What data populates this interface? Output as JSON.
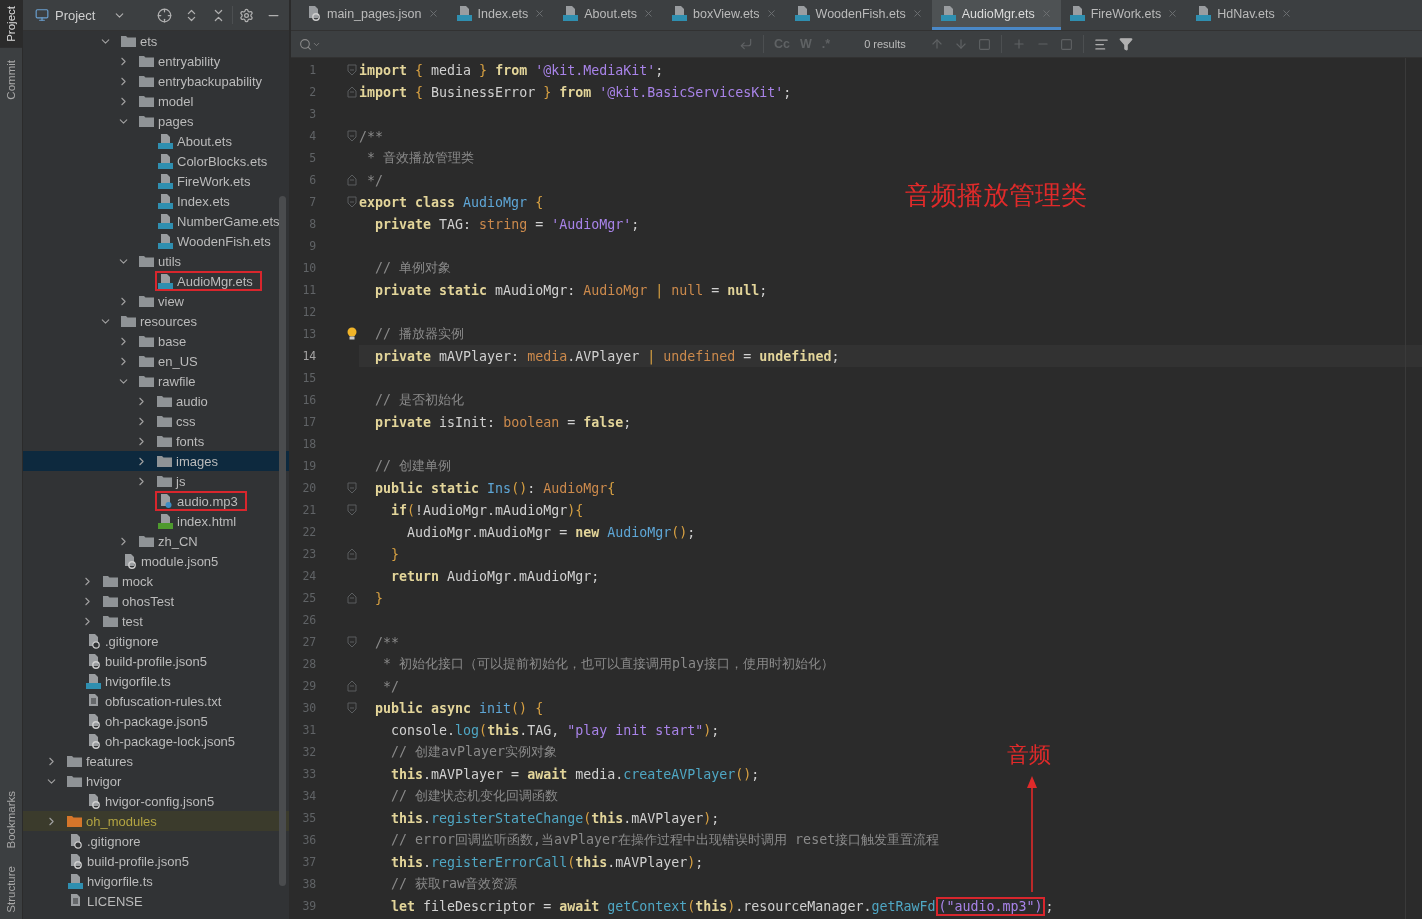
{
  "tool_windows": {
    "top": [
      {
        "label": "Project",
        "selected": true
      },
      {
        "label": "Commit",
        "selected": false
      }
    ],
    "bottom": [
      {
        "label": "Bookmarks",
        "selected": false
      },
      {
        "label": "Structure",
        "selected": false
      }
    ]
  },
  "project_panel": {
    "title": "Project"
  },
  "tree": [
    {
      "children": [
        {
          "children": [
            {
              "children": [
                {
                  "label": "ets",
                  "kind": "folder",
                  "expanded": true,
                  "selected": false,
                  "highlighted": false,
                  "excluded": false,
                  "children": [
                    {
                      "label": "entryability",
                      "kind": "folder",
                      "expanded": false,
                      "selected": false,
                      "highlighted": false,
                      "excluded": false
                    },
                    {
                      "label": "entrybackupability",
                      "kind": "folder",
                      "expanded": false,
                      "selected": false,
                      "highlighted": false,
                      "excluded": false
                    },
                    {
                      "label": "model",
                      "kind": "folder",
                      "expanded": false,
                      "selected": false,
                      "highlighted": false,
                      "excluded": false
                    },
                    {
                      "label": "pages",
                      "kind": "folder",
                      "expanded": true,
                      "selected": false,
                      "highlighted": false,
                      "excluded": false,
                      "children": [
                        {
                          "label": "About.ets",
                          "kind": "ets",
                          "selected": false,
                          "highlighted": false,
                          "excluded": false
                        },
                        {
                          "label": "ColorBlocks.ets",
                          "kind": "ets",
                          "selected": false,
                          "highlighted": false,
                          "excluded": false
                        },
                        {
                          "label": "FireWork.ets",
                          "kind": "ets",
                          "selected": false,
                          "highlighted": false,
                          "excluded": false
                        },
                        {
                          "label": "Index.ets",
                          "kind": "ets",
                          "selected": false,
                          "highlighted": false,
                          "excluded": false
                        },
                        {
                          "label": "NumberGame.ets",
                          "kind": "ets",
                          "selected": false,
                          "highlighted": false,
                          "excluded": false
                        },
                        {
                          "label": "WoodenFish.ets",
                          "kind": "ets",
                          "selected": false,
                          "highlighted": false,
                          "excluded": false
                        }
                      ]
                    },
                    {
                      "label": "utils",
                      "kind": "folder",
                      "expanded": true,
                      "selected": false,
                      "highlighted": false,
                      "excluded": false,
                      "children": [
                        {
                          "label": "AudioMgr.ets",
                          "kind": "ets",
                          "selected": false,
                          "highlighted": true,
                          "excluded": false
                        }
                      ]
                    },
                    {
                      "label": "view",
                      "kind": "folder",
                      "expanded": false,
                      "selected": false,
                      "highlighted": false,
                      "excluded": false
                    }
                  ]
                },
                {
                  "label": "resources",
                  "kind": "folder",
                  "expanded": true,
                  "selected": false,
                  "highlighted": false,
                  "excluded": false,
                  "children": [
                    {
                      "label": "base",
                      "kind": "folder",
                      "expanded": false,
                      "selected": false,
                      "highlighted": false,
                      "excluded": false
                    },
                    {
                      "label": "en_US",
                      "kind": "folder",
                      "expanded": false,
                      "selected": false,
                      "highlighted": false,
                      "excluded": false
                    },
                    {
                      "label": "rawfile",
                      "kind": "folder",
                      "expanded": true,
                      "selected": false,
                      "highlighted": false,
                      "excluded": false,
                      "children": [
                        {
                          "label": "audio",
                          "kind": "folder",
                          "expanded": false,
                          "selected": false,
                          "highlighted": false,
                          "excluded": false
                        },
                        {
                          "label": "css",
                          "kind": "folder",
                          "expanded": false,
                          "selected": false,
                          "highlighted": false,
                          "excluded": false
                        },
                        {
                          "label": "fonts",
                          "kind": "folder",
                          "expanded": false,
                          "selected": false,
                          "highlighted": false,
                          "excluded": false
                        },
                        {
                          "label": "images",
                          "kind": "folder",
                          "expanded": false,
                          "selected": true,
                          "highlighted": false,
                          "excluded": false
                        },
                        {
                          "label": "js",
                          "kind": "folder",
                          "expanded": false,
                          "selected": false,
                          "highlighted": false,
                          "excluded": false
                        },
                        {
                          "label": "audio.mp3",
                          "kind": "unknown",
                          "selected": false,
                          "highlighted": true,
                          "excluded": false
                        },
                        {
                          "label": "index.html",
                          "kind": "html",
                          "selected": false,
                          "highlighted": false,
                          "excluded": false
                        }
                      ]
                    },
                    {
                      "label": "zh_CN",
                      "kind": "folder",
                      "expanded": false,
                      "selected": false,
                      "highlighted": false,
                      "excluded": false
                    }
                  ]
                },
                {
                  "label": "module.json5",
                  "kind": "json",
                  "selected": false,
                  "highlighted": false,
                  "excluded": false
                }
              ]
            },
            {
              "label": "mock",
              "kind": "folder",
              "expanded": false,
              "selected": false,
              "highlighted": false,
              "excluded": false
            },
            {
              "label": "ohosTest",
              "kind": "folder",
              "expanded": false,
              "selected": false,
              "highlighted": false,
              "excluded": false
            },
            {
              "label": "test",
              "kind": "folder",
              "expanded": false,
              "selected": false,
              "highlighted": false,
              "excluded": false
            }
          ]
        },
        {
          "label": ".gitignore",
          "kind": "ignore",
          "selected": false,
          "highlighted": false,
          "excluded": false
        },
        {
          "label": "build-profile.json5",
          "kind": "json",
          "selected": false,
          "highlighted": false,
          "excluded": false
        },
        {
          "label": "hvigorfile.ts",
          "kind": "ts",
          "selected": false,
          "highlighted": false,
          "excluded": false
        },
        {
          "label": "obfuscation-rules.txt",
          "kind": "txt",
          "selected": false,
          "highlighted": false,
          "excluded": false
        },
        {
          "label": "oh-package.json5",
          "kind": "json",
          "selected": false,
          "highlighted": false,
          "excluded": false
        },
        {
          "label": "oh-package-lock.json5",
          "kind": "json",
          "selected": false,
          "highlighted": false,
          "excluded": false
        }
      ]
    },
    {
      "label": "features",
      "kind": "folder",
      "expanded": false,
      "selected": false,
      "highlighted": false,
      "excluded": false
    },
    {
      "label": "hvigor",
      "kind": "folder",
      "expanded": true,
      "selected": false,
      "highlighted": false,
      "excluded": false,
      "children": [
        {
          "label": "hvigor-config.json5",
          "kind": "json",
          "selected": false,
          "highlighted": false,
          "excluded": false
        }
      ]
    },
    {
      "label": "oh_modules",
      "kind": "folder",
      "expanded": false,
      "selected": false,
      "highlighted": false,
      "excluded": true
    },
    {
      "label": ".gitignore",
      "kind": "ignore",
      "selected": false,
      "highlighted": false,
      "excluded": false
    },
    {
      "label": "build-profile.json5",
      "kind": "json",
      "selected": false,
      "highlighted": false,
      "excluded": false
    },
    {
      "label": "hvigorfile.ts",
      "kind": "ts",
      "selected": false,
      "highlighted": false,
      "excluded": false
    },
    {
      "label": "LICENSE",
      "kind": "txt",
      "selected": false,
      "highlighted": false,
      "excluded": false
    }
  ],
  "tabs": [
    {
      "label": "main_pages.json",
      "kind": "json",
      "selected": false
    },
    {
      "label": "Index.ets",
      "kind": "ets",
      "selected": false
    },
    {
      "label": "About.ets",
      "kind": "ets",
      "selected": false
    },
    {
      "label": "boxView.ets",
      "kind": "ets",
      "selected": false
    },
    {
      "label": "WoodenFish.ets",
      "kind": "ets",
      "selected": false
    },
    {
      "label": "AudioMgr.ets",
      "kind": "ets",
      "selected": true
    },
    {
      "label": "FireWork.ets",
      "kind": "ets",
      "selected": false
    },
    {
      "label": "HdNav.ets",
      "kind": "ets",
      "selected": false
    }
  ],
  "find_bar": {
    "options": [
      "Cc",
      "W",
      ".*"
    ],
    "results": "0 results"
  },
  "code": [
    {
      "number": "1",
      "fold_start": true,
      "current": false,
      "tokens": [
        {
          "kind": "kw",
          "text": "import"
        },
        {
          "kind": "br",
          "text": " {"
        },
        {
          "kind": "p",
          "text": " media "
        },
        {
          "kind": "br",
          "text": "}"
        },
        {
          "kind": "kw",
          "text": " from"
        },
        {
          "kind": "str",
          "text": " '@kit.MediaKit'"
        },
        {
          "kind": "p",
          "text": ";"
        }
      ]
    },
    {
      "number": "2",
      "fold_end": true,
      "current": false,
      "tokens": [
        {
          "kind": "kw",
          "text": "import"
        },
        {
          "kind": "br",
          "text": " {"
        },
        {
          "kind": "p",
          "text": " BusinessError "
        },
        {
          "kind": "br",
          "text": "}"
        },
        {
          "kind": "kw",
          "text": " from"
        },
        {
          "kind": "str",
          "text": " '@kit.BasicServicesKit'"
        },
        {
          "kind": "p",
          "text": ";"
        }
      ]
    },
    {
      "number": "3",
      "current": false
    },
    {
      "number": "4",
      "fold_start": true,
      "current": false,
      "tokens": [
        {
          "kind": "cmt",
          "text": "/**"
        }
      ]
    },
    {
      "number": "5",
      "current": false,
      "tokens": [
        {
          "kind": "cmt",
          "text": " * 音效播放管理类"
        }
      ]
    },
    {
      "number": "6",
      "fold_end": true,
      "current": false,
      "tokens": [
        {
          "kind": "cmt",
          "text": " */"
        }
      ]
    },
    {
      "number": "7",
      "fold_start": true,
      "current": false,
      "tokens": [
        {
          "kind": "kw",
          "text": "export class"
        },
        {
          "kind": "cls",
          "text": " AudioMgr"
        },
        {
          "kind": "br",
          "text": " {"
        }
      ]
    },
    {
      "number": "8",
      "current": false,
      "tokens": [
        {
          "kind": "kw",
          "text": "  private"
        },
        {
          "kind": "p",
          "text": " TAG: "
        },
        {
          "kind": "type",
          "text": "string"
        },
        {
          "kind": "p",
          "text": " = "
        },
        {
          "kind": "str",
          "text": "'AudioMgr'"
        },
        {
          "kind": "p",
          "text": ";"
        }
      ]
    },
    {
      "number": "9",
      "current": false
    },
    {
      "number": "10",
      "current": false,
      "tokens": [
        {
          "kind": "cmt",
          "text": "  // 单例对象"
        }
      ]
    },
    {
      "number": "11",
      "current": false,
      "tokens": [
        {
          "kind": "kw",
          "text": "  private static"
        },
        {
          "kind": "p",
          "text": " mAudioMgr: "
        },
        {
          "kind": "type",
          "text": "AudioMgr"
        },
        {
          "kind": "br",
          "text": " | "
        },
        {
          "kind": "type",
          "text": "null"
        },
        {
          "kind": "p",
          "text": " = "
        },
        {
          "kind": "kw",
          "text": "null"
        },
        {
          "kind": "p",
          "text": ";"
        }
      ]
    },
    {
      "number": "12",
      "current": false
    },
    {
      "number": "13",
      "bulb": true,
      "current": false,
      "tokens": [
        {
          "kind": "cmt",
          "text": "  // 播放器实例"
        }
      ]
    },
    {
      "number": "14",
      "current": true,
      "tokens": [
        {
          "kind": "kw",
          "text": "  private"
        },
        {
          "kind": "p",
          "text": " mAVPlayer: "
        },
        {
          "kind": "type",
          "text": "media"
        },
        {
          "kind": "p",
          "text": ".AVPlayer "
        },
        {
          "kind": "br",
          "text": "|"
        },
        {
          "kind": "type",
          "text": " undefined"
        },
        {
          "kind": "p",
          "text": " = "
        },
        {
          "kind": "kw",
          "text": "undefined"
        },
        {
          "kind": "p",
          "text": ";"
        }
      ]
    },
    {
      "number": "15",
      "current": false
    },
    {
      "number": "16",
      "current": false,
      "tokens": [
        {
          "kind": "cmt",
          "text": "  // 是否初始化"
        }
      ]
    },
    {
      "number": "17",
      "current": false,
      "tokens": [
        {
          "kind": "kw",
          "text": "  private"
        },
        {
          "kind": "p",
          "text": " isInit: "
        },
        {
          "kind": "type",
          "text": "boolean"
        },
        {
          "kind": "p",
          "text": " = "
        },
        {
          "kind": "kw",
          "text": "false"
        },
        {
          "kind": "p",
          "text": ";"
        }
      ]
    },
    {
      "number": "18",
      "current": false
    },
    {
      "number": "19",
      "current": false,
      "tokens": [
        {
          "kind": "cmt",
          "text": "  // 创建单例"
        }
      ]
    },
    {
      "number": "20",
      "fold_start": true,
      "current": false,
      "tokens": [
        {
          "kind": "kw",
          "text": "  public static"
        },
        {
          "kind": "cls",
          "text": " Ins"
        },
        {
          "kind": "br",
          "text": "()"
        },
        {
          "kind": "p",
          "text": ": "
        },
        {
          "kind": "type",
          "text": "AudioMgr"
        },
        {
          "kind": "br",
          "text": "{"
        }
      ]
    },
    {
      "number": "21",
      "fold_start": true,
      "current": false,
      "tokens": [
        {
          "kind": "kw",
          "text": "    if"
        },
        {
          "kind": "br",
          "text": "("
        },
        {
          "kind": "p",
          "text": "!AudioMgr.mAudioMgr"
        },
        {
          "kind": "br",
          "text": "){"
        }
      ]
    },
    {
      "number": "22",
      "current": false,
      "tokens": [
        {
          "kind": "p",
          "text": "      AudioMgr.mAudioMgr = "
        },
        {
          "kind": "kw",
          "text": "new"
        },
        {
          "kind": "cls",
          "text": " AudioMgr"
        },
        {
          "kind": "br",
          "text": "()"
        },
        {
          "kind": "p",
          "text": ";"
        }
      ]
    },
    {
      "number": "23",
      "fold_end": true,
      "current": false,
      "tokens": [
        {
          "kind": "br",
          "text": "    }"
        }
      ]
    },
    {
      "number": "24",
      "current": false,
      "tokens": [
        {
          "kind": "kw",
          "text": "    return"
        },
        {
          "kind": "p",
          "text": " AudioMgr.mAudioMgr;"
        }
      ]
    },
    {
      "number": "25",
      "fold_end": true,
      "current": false,
      "tokens": [
        {
          "kind": "br",
          "text": "  }"
        }
      ]
    },
    {
      "number": "26",
      "current": false
    },
    {
      "number": "27",
      "fold_start": true,
      "current": false,
      "tokens": [
        {
          "kind": "cmt",
          "text": "  /**"
        }
      ]
    },
    {
      "number": "28",
      "current": false,
      "tokens": [
        {
          "kind": "cmt",
          "text": "   * 初始化接口（可以提前初始化，也可以直接调用play接口，使用时初始化）"
        }
      ]
    },
    {
      "number": "29",
      "fold_end": true,
      "current": false,
      "tokens": [
        {
          "kind": "cmt",
          "text": "   */"
        }
      ]
    },
    {
      "number": "30",
      "fold_start": true,
      "current": false,
      "tokens": [
        {
          "kind": "kw",
          "text": "  public async"
        },
        {
          "kind": "cls",
          "text": " init"
        },
        {
          "kind": "br",
          "text": "()"
        },
        {
          "kind": "br",
          "text": " {"
        }
      ]
    },
    {
      "number": "31",
      "current": false,
      "tokens": [
        {
          "kind": "p",
          "text": "    console."
        },
        {
          "kind": "fn",
          "text": "log"
        },
        {
          "kind": "br",
          "text": "("
        },
        {
          "kind": "kw",
          "text": "this"
        },
        {
          "kind": "p",
          "text": ".TAG, "
        },
        {
          "kind": "str",
          "text": "\"play init start\""
        },
        {
          "kind": "br",
          "text": ")"
        },
        {
          "kind": "p",
          "text": ";"
        }
      ]
    },
    {
      "number": "32",
      "current": false,
      "tokens": [
        {
          "kind": "cmt",
          "text": "    // 创建avPlayer实例对象"
        }
      ]
    },
    {
      "number": "33",
      "current": false,
      "tokens": [
        {
          "kind": "kw",
          "text": "    this"
        },
        {
          "kind": "p",
          "text": ".mAVPlayer = "
        },
        {
          "kind": "kw",
          "text": "await"
        },
        {
          "kind": "p",
          "text": " media."
        },
        {
          "kind": "fn",
          "text": "createAVPlayer"
        },
        {
          "kind": "br",
          "text": "()"
        },
        {
          "kind": "p",
          "text": ";"
        }
      ]
    },
    {
      "number": "34",
      "current": false,
      "tokens": [
        {
          "kind": "cmt",
          "text": "    // 创建状态机变化回调函数"
        }
      ]
    },
    {
      "number": "35",
      "current": false,
      "tokens": [
        {
          "kind": "kw",
          "text": "    this"
        },
        {
          "kind": "p",
          "text": "."
        },
        {
          "kind": "fn",
          "text": "registerStateChange"
        },
        {
          "kind": "br",
          "text": "("
        },
        {
          "kind": "kw",
          "text": "this"
        },
        {
          "kind": "p",
          "text": ".mAVPlayer"
        },
        {
          "kind": "br",
          "text": ")"
        },
        {
          "kind": "p",
          "text": ";"
        }
      ]
    },
    {
      "number": "36",
      "current": false,
      "tokens": [
        {
          "kind": "cmt",
          "text": "    // error回调监听函数,当avPlayer在操作过程中出现错误时调用 reset接口触发重置流程"
        }
      ]
    },
    {
      "number": "37",
      "current": false,
      "tokens": [
        {
          "kind": "kw",
          "text": "    this"
        },
        {
          "kind": "p",
          "text": "."
        },
        {
          "kind": "fn",
          "text": "registerErrorCall"
        },
        {
          "kind": "br",
          "text": "("
        },
        {
          "kind": "kw",
          "text": "this"
        },
        {
          "kind": "p",
          "text": ".mAVPlayer"
        },
        {
          "kind": "br",
          "text": ")"
        },
        {
          "kind": "p",
          "text": ";"
        }
      ]
    },
    {
      "number": "38",
      "current": false,
      "tokens": [
        {
          "kind": "cmt",
          "text": "    // 获取raw音效资源"
        }
      ]
    },
    {
      "number": "39",
      "current": false,
      "tokens": [
        {
          "kind": "kw",
          "text": "    let"
        },
        {
          "kind": "p",
          "text": " fileDescriptor = "
        },
        {
          "kind": "kw",
          "text": "await"
        },
        {
          "kind": "fn",
          "text": " getContext"
        },
        {
          "kind": "br",
          "text": "("
        },
        {
          "kind": "kw",
          "text": "this"
        },
        {
          "kind": "br",
          "text": ")"
        },
        {
          "kind": "p",
          "text": ".resourceManager."
        },
        {
          "kind": "fn",
          "text": "getRawFd"
        },
        {
          "kind": "str",
          "text": "(\"audio.mp3\")",
          "marked": true
        },
        {
          "kind": "p",
          "text": ";"
        }
      ]
    }
  ],
  "annotations": [
    {
      "text": "音频播放管理类",
      "arrow": false
    },
    {
      "text": "音频",
      "arrow": true
    }
  ]
}
